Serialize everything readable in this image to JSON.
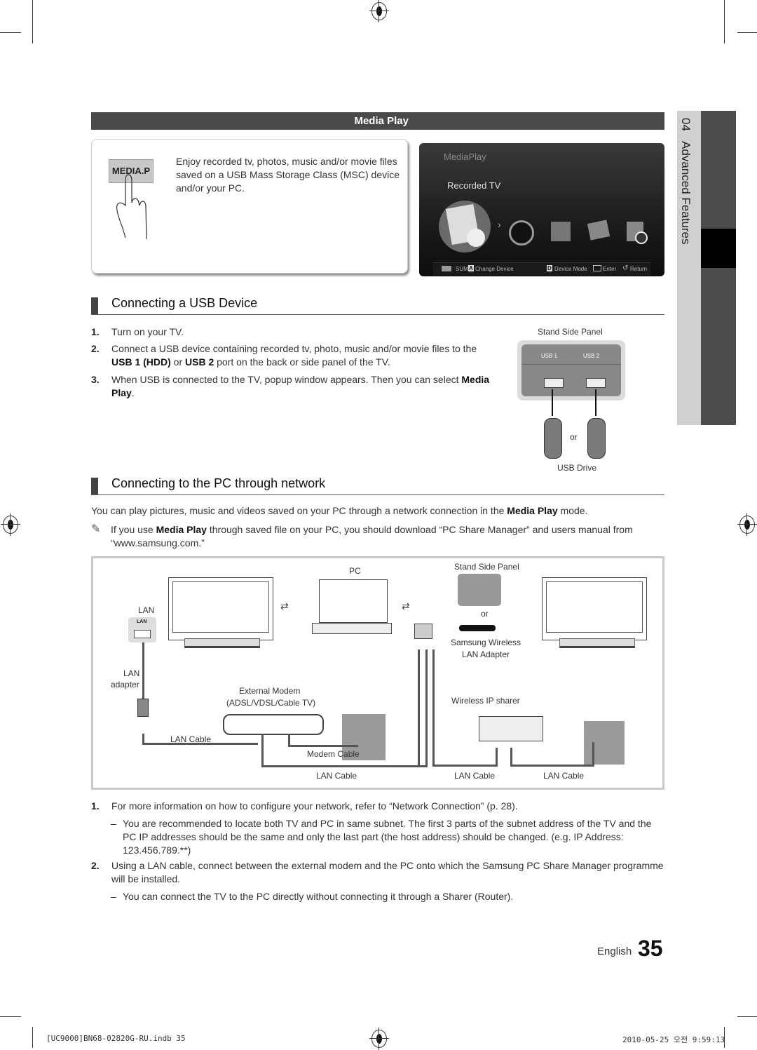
{
  "media_play_section": {
    "bar_title": "Media Play",
    "button_label": "MEDIA.P",
    "description": "Enjoy recorded tv, photos, music and/or movie files saved on a USB Mass Storage Class (MSC) device and/or your PC.",
    "tv_screen": {
      "app_title": "MediaPlay",
      "selected_item": "Recorded TV",
      "icons": [
        "recorded-tv",
        "videos",
        "music",
        "photos",
        "setup"
      ],
      "bottom_bar": {
        "sum_label": "SUM",
        "a_key": "A",
        "change_device": "Change Device",
        "d_key": "D",
        "device_mode": "Device Mode",
        "enter": "Enter",
        "return": "Return"
      }
    }
  },
  "side_tab": {
    "chapter": "04",
    "title": "Advanced Features"
  },
  "usb_section": {
    "heading": "Connecting a USB Device",
    "steps": [
      {
        "num": "1.",
        "text": "Turn on your TV."
      },
      {
        "num": "2.",
        "pre": "Connect a USB device containing recorded tv, photo, music and/or movie files to the ",
        "b1": "USB 1 (HDD)",
        "mid": " or ",
        "b2": "USB 2",
        "post": " port on the back or side panel of the TV."
      },
      {
        "num": "3.",
        "pre": "When USB is connected to the TV, popup window appears. Then you can select ",
        "b1": "Media Play",
        "post": "."
      }
    ],
    "figure": {
      "panel_label": "Stand Side Panel",
      "port1": "USB 1",
      "port2": "USB 2",
      "or": "or",
      "drive_label": "USB Drive"
    }
  },
  "network_section": {
    "heading": "Connecting to the PC through network",
    "intro_pre": "You can play pictures, music and videos saved on your PC through a network connection in the ",
    "intro_bold": "Media Play",
    "intro_post": " mode.",
    "note_pre": "If you use ",
    "note_bold": "Media Play",
    "note_post": " through saved file on your PC, you should download “PC Share Manager” and users manual from “www.samsung.com.”",
    "diagram": {
      "pc": "PC",
      "stand_side_panel": "Stand Side Panel",
      "lan": "LAN",
      "lan_port": "LAN",
      "or": "or",
      "wireless_adapter": "Samsung Wireless\nLAN Adapter",
      "lan_adapter_1": "LAN",
      "lan_adapter_2": "adapter",
      "external_modem_1": "External Modem",
      "external_modem_2": "(ADSL/VDSL/Cable TV)",
      "wireless_ip_sharer": "Wireless IP sharer",
      "lan_cable_left": "LAN Cable",
      "modem_cable": "Modem Cable",
      "lan_cable_bottom": "LAN Cable",
      "lan_cable_mid": "LAN Cable",
      "lan_cable_right": "LAN Cable"
    },
    "steps": [
      {
        "num": "1.",
        "text": "For more information on how to configure your network, refer to “Network Connection” (p. 28)."
      },
      {
        "num": "–",
        "text": "You are recommended to locate both TV and PC in same subnet. The first 3 parts of the subnet address of the TV and the PC IP addresses should be the same and only the last part (the host address) should be changed. (e.g. IP Address: 123.456.789.**)"
      },
      {
        "num": "2.",
        "text": "Using a LAN cable, connect between the external modem and the PC onto which the Samsung PC Share Manager programme will be installed."
      },
      {
        "num": "–",
        "text": "You can connect the TV to the PC directly without connecting it through a Sharer (Router)."
      }
    ]
  },
  "footer": {
    "language": "English",
    "page_number": "35",
    "slug_left": "[UC9000]BN68-02820G-RU.indb   35",
    "slug_right": "2010-05-25   오전 9:59:13"
  }
}
